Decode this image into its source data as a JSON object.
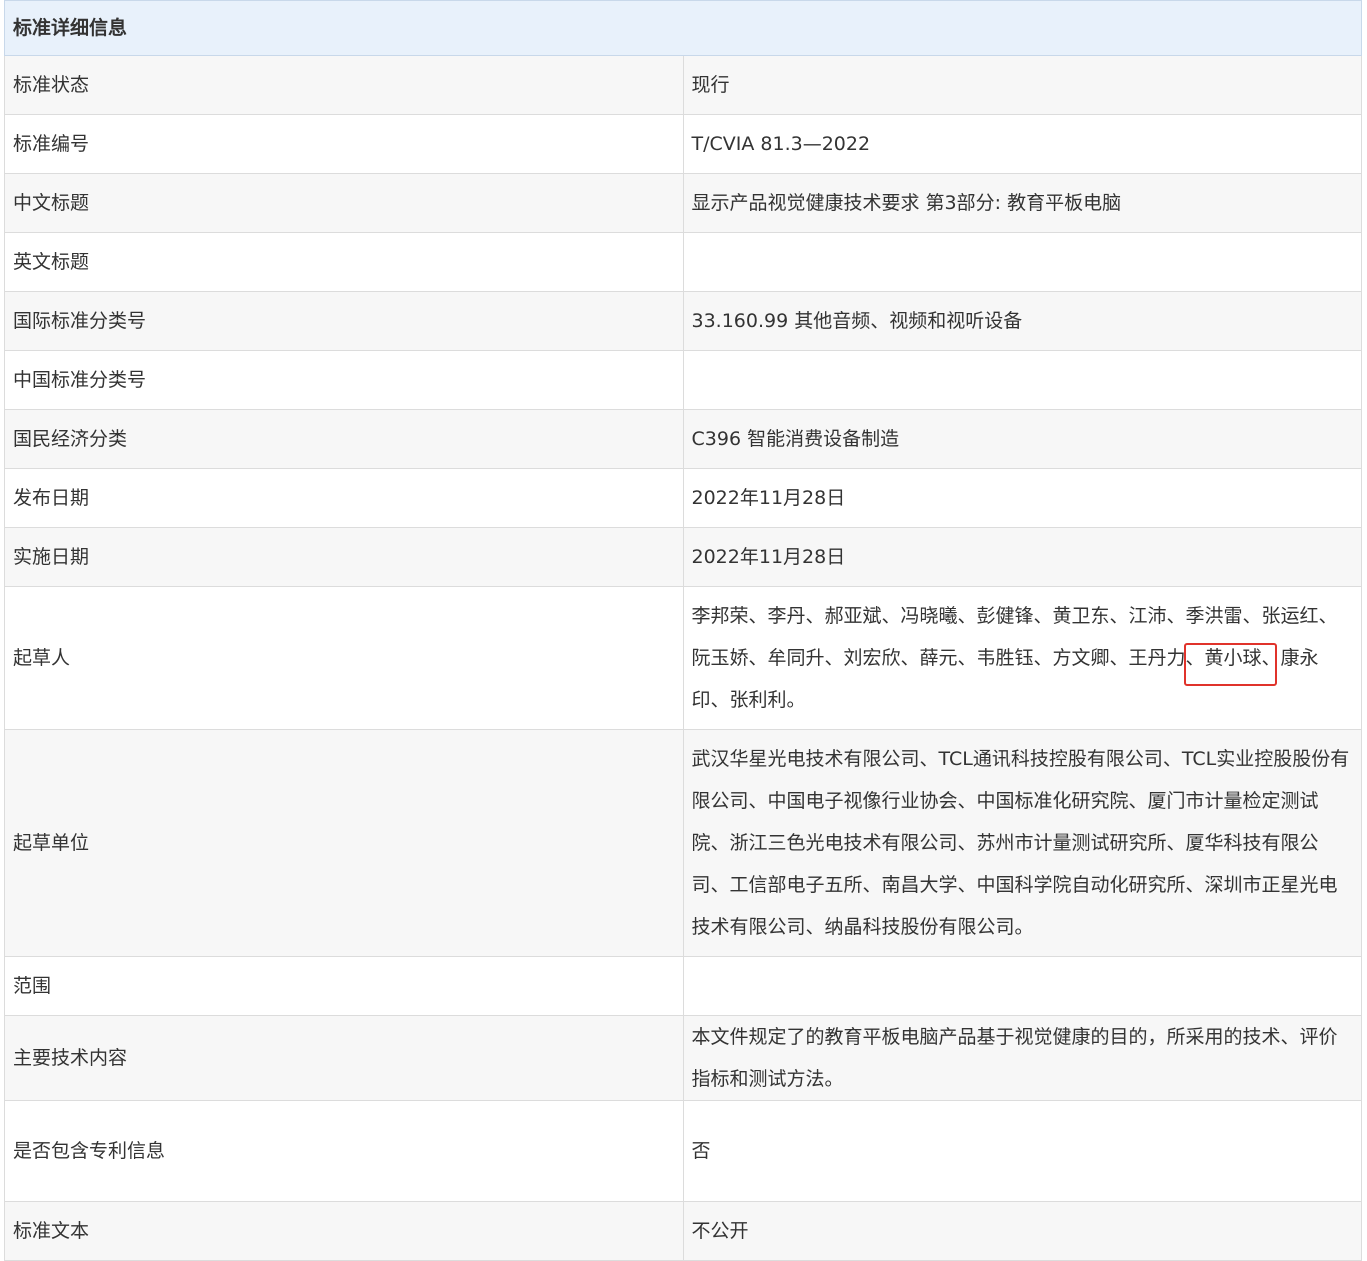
{
  "header": {
    "title": "标准详细信息"
  },
  "rows": [
    {
      "label": "标准状态",
      "value": "现行"
    },
    {
      "label": "标准编号",
      "value": "T/CVIA 81.3—2022"
    },
    {
      "label": "中文标题",
      "value": "显示产品视觉健康技术要求 第3部分: 教育平板电脑"
    },
    {
      "label": "英文标题",
      "value": ""
    },
    {
      "label": "国际标准分类号",
      "value": "33.160.99 其他音频、视频和视听设备"
    },
    {
      "label": "中国标准分类号",
      "value": ""
    },
    {
      "label": "国民经济分类",
      "value": "C396 智能消费设备制造"
    },
    {
      "label": "发布日期",
      "value": "2022年11月28日"
    },
    {
      "label": "实施日期",
      "value": "2022年11月28日"
    }
  ],
  "drafters": {
    "label": "起草人",
    "before": "李邦荣、李丹、郝亚斌、冯晓曦、彭健锋、黄卫东、江沛、季洪雷、张运红、阮玉娇、牟同升、刘宏欣、薛元、韦胜钰、方文卿、王丹力、",
    "highlight": "黄小球、",
    "after": "康永印、张利利。"
  },
  "units": {
    "label": "起草单位",
    "value": "武汉华星光电技术有限公司、TCL通讯科技控股有限公司、TCL实业控股股份有限公司、中国电子视像行业协会、中国标准化研究院、厦门市计量检定测试院、浙江三色光电技术有限公司、苏州市计量测试研究所、厦华科技有限公司、工信部电子五所、南昌大学、中国科学院自动化研究所、深圳市正星光电技术有限公司、纳晶科技股份有限公司。"
  },
  "rows2": [
    {
      "label": "范围",
      "value": ""
    },
    {
      "label": "主要技术内容",
      "value": "本文件规定了的教育平板电脑产品基于视觉健康的目的，所采用的技术、评价指标和测试方法。"
    },
    {
      "label": "是否包含专利信息",
      "value": "否"
    },
    {
      "label": "标准文本",
      "value": "不公开"
    }
  ],
  "colors": {
    "header_bg": "#e8f1fb",
    "highlight_border": "#e0332b",
    "alt_row": "#f7f7f7"
  }
}
